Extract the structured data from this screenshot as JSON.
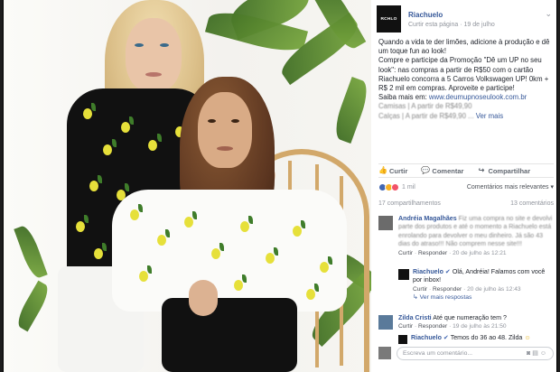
{
  "page": {
    "name": "Riachuelo",
    "logo_text": "RCHLO",
    "subtitle_link": "Curtir esta página",
    "date": "19 de julho",
    "menu_icon": "chevron-down-icon"
  },
  "post": {
    "p1": "Quando a vida te der limões, adicione à produção e dê um toque fun ao look!",
    "p2": "Compre e participe da Promoção \"Dê um UP no seu look\": nas compras a partir de R$50 com o cartão Riachuelo concorra a 5 Carros Volkswagen UP! 0km + R$ 2 mil em compras. Aproveite e participe!",
    "p3_prefix": "Saiba mais em:",
    "p3_link": "www.deumupnoseulook.com.br",
    "p4": "Camisas | A partir de R$49,90",
    "p5_prefix": "Calças | A partir de R$49,90 ...",
    "p5_more": "Ver mais"
  },
  "actions": {
    "like": "Curtir",
    "comment": "Comentar",
    "share": "Compartilhar"
  },
  "reactions": {
    "count": "1 mil",
    "relevant": "Comentários mais relevantes",
    "colors": {
      "like": "#4267b2",
      "wow": "#f7b125",
      "love": "#f25268"
    }
  },
  "shares": {
    "left": "17 compartilhamentos",
    "right": "13 comentários"
  },
  "comments": [
    {
      "name": "Andréia Magalhães",
      "text": "Fiz uma compra no site e devolvi parte dos produtos e até o momento a Riachuelo está enrolando para devolver o meu dinheiro. Já são 43 dias do atraso!!! Não comprem nesse site!!!",
      "like": "Curtir",
      "reply": "Responder",
      "time": "20 de julho às 12:21"
    },
    {
      "name": "Riachuelo",
      "text": "Olá, Andréia! Falamos com você por inbox!",
      "like": "Curtir",
      "reply": "Responder",
      "time": "20 de julho às 12:43",
      "replies": "Ver mais respostas"
    },
    {
      "name": "Zilda Cristi",
      "text": "Até que numeração tem ?",
      "like": "Curtir",
      "reply": "Responder",
      "time": "19 de julho às 21:50"
    },
    {
      "name": "Riachuelo",
      "text": "Temos do 36 ao 48. Zilda",
      "emoji": "☺"
    }
  ],
  "compose": {
    "placeholder": "Escreva um comentário..."
  }
}
